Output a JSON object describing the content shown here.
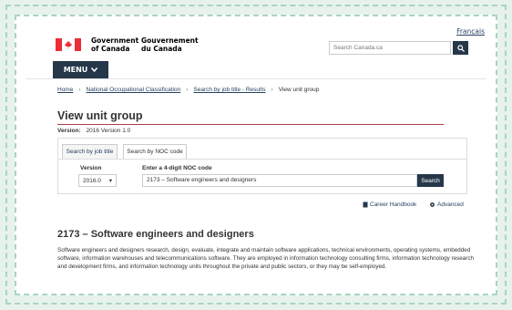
{
  "header": {
    "lang_toggle": "Français",
    "signature_en_line1": "Government",
    "signature_en_line2": "of Canada",
    "signature_fr_line1": "Gouvernement",
    "signature_fr_line2": "du Canada",
    "search_placeholder": "Search Canada.ca",
    "search_icon": "search-icon",
    "flag_icon": "maple-leaf-icon"
  },
  "nav": {
    "menu_label": "MENU",
    "menu_icon": "chevron-down-icon"
  },
  "breadcrumb": {
    "items": [
      "Home",
      "National Occupational Classification",
      "Search by job title - Results",
      "View unit group"
    ]
  },
  "main": {
    "title": "View unit group",
    "version_label": "Version:",
    "version_value": "2016 Version 1.0"
  },
  "search": {
    "tabs": [
      "Search by job title",
      "Search by NOC code"
    ],
    "version_label": "Version",
    "version_selected": "2016.0",
    "noc_label": "Enter a 4-digit NOC code",
    "noc_value": "2173 – Software engineers and designers",
    "search_button": "Search"
  },
  "tools": {
    "career_handbook": "Career Handbook",
    "career_icon": "book-icon",
    "advanced": "Advanced",
    "advanced_icon": "gear-icon"
  },
  "unit_group": {
    "title": "2173 – Software engineers and designers",
    "description": "Software engineers and designers research, design, evaluate, integrate and maintain software applications, technical environments, operating systems, embedded software, information warehouses and telecommunications software. They are employed in information technology consulting firms, information technology research and development firms, and information technology units throughout the private and public sectors, or they may be self-employed."
  },
  "colors": {
    "accent": "#26374a",
    "title_rule": "#af3c43",
    "frame": "#a8d5bf",
    "background": "#e8f2ec"
  }
}
